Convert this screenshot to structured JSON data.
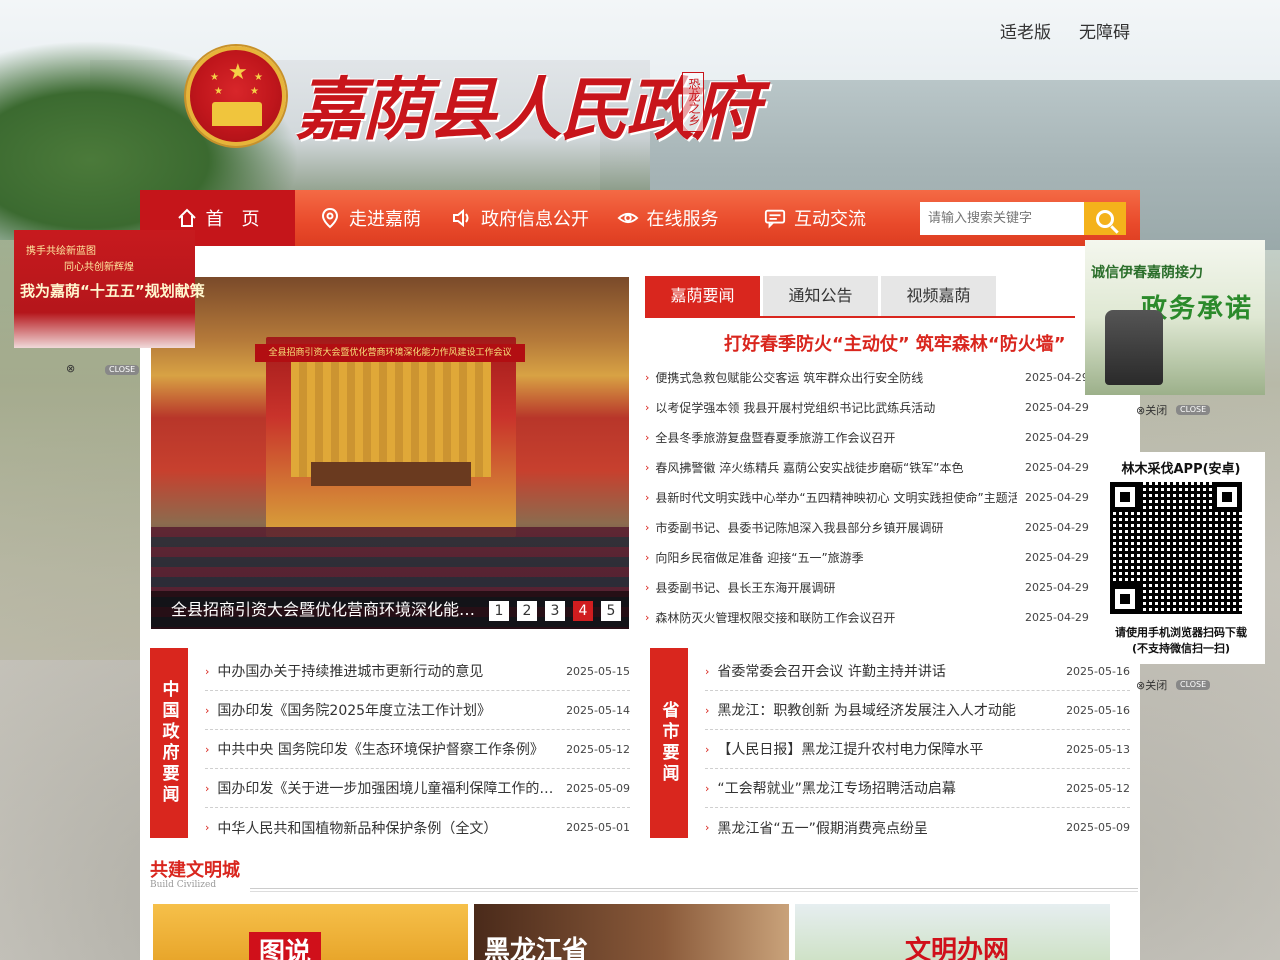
{
  "header": {
    "site_title": "嘉荫县人民政府",
    "seal_text": "恐龙之乡",
    "top_links": [
      "适老版",
      "无障碍"
    ]
  },
  "nav": {
    "items": [
      {
        "label": "首　页",
        "icon": "home-icon"
      },
      {
        "label": "走进嘉荫",
        "icon": "location-pin-icon"
      },
      {
        "label": "政府信息公开",
        "icon": "speaker-icon"
      },
      {
        "label": "在线服务",
        "icon": "eye-icon"
      },
      {
        "label": "互动交流",
        "icon": "chat-icon"
      }
    ],
    "search_placeholder": "请输入搜索关键字"
  },
  "slider": {
    "banner_text": "全县招商引资大会暨优化营商环境深化能力作风建设工作会议",
    "caption": "全县招商引资大会暨优化营商环境深化能力作风建设工作会议",
    "dots": [
      "1",
      "2",
      "3",
      "4",
      "5"
    ],
    "active_dot": 3
  },
  "news_tabs": {
    "tabs": [
      "嘉荫要闻",
      "通知公告",
      "视频嘉荫"
    ],
    "headline": "打好春季防火“主动仗” 筑牢森林“防火墙”",
    "items": [
      {
        "title": "便携式急救包赋能公交客运 筑牢群众出行安全防线",
        "date": "2025-04-29"
      },
      {
        "title": "以考促学强本领 我县开展村党组织书记比武练兵活动",
        "date": "2025-04-29"
      },
      {
        "title": "全县冬季旅游复盘暨春夏季旅游工作会议召开",
        "date": "2025-04-29"
      },
      {
        "title": "春风拂警徽 淬火练精兵 嘉荫公安实战徒步磨砺“铁军”本色",
        "date": "2025-04-29"
      },
      {
        "title": "县新时代文明实践中心举办“五四精神映初心 文明实践担使命”主题活动",
        "date": "2025-04-29"
      },
      {
        "title": "市委副书记、县委书记陈旭深入我县部分乡镇开展调研",
        "date": "2025-04-29"
      },
      {
        "title": "向阳乡民宿做足准备 迎接“五一”旅游季",
        "date": "2025-04-29"
      },
      {
        "title": "县委副书记、县长王东海开展调研",
        "date": "2025-04-29"
      },
      {
        "title": "森林防灭火管理权限交接和联防工作会议召开",
        "date": "2025-04-29"
      }
    ]
  },
  "china_news": {
    "tag": "中国政府要闻",
    "items": [
      {
        "title": "中办国办关于持续推进城市更新行动的意见",
        "date": "2025-05-15"
      },
      {
        "title": "国办印发《国务院2025年度立法工作计划》",
        "date": "2025-05-14"
      },
      {
        "title": "中共中央 国务院印发《生态环境保护督察工作条例》",
        "date": "2025-05-12"
      },
      {
        "title": "国办印发《关于进一步加强困境儿童福利保障工作的意见》",
        "date": "2025-05-09"
      },
      {
        "title": "中华人民共和国植物新品种保护条例（全文）",
        "date": "2025-05-01"
      }
    ]
  },
  "province_news": {
    "tag": "省市要闻",
    "items": [
      {
        "title": "省委常委会召开会议 许勤主持并讲话",
        "date": "2025-05-16"
      },
      {
        "title": "黑龙江：职教创新 为县域经济发展注入人才动能",
        "date": "2025-05-16"
      },
      {
        "title": "【人民日报】黑龙江提升农村电力保障水平",
        "date": "2025-05-13"
      },
      {
        "title": "“工会帮就业”黑龙江专场招聘活动启幕",
        "date": "2025-05-12"
      },
      {
        "title": "黑龙江省“五一”假期消费亮点纷呈",
        "date": "2025-05-09"
      }
    ]
  },
  "civilized": {
    "title": "共建文明城",
    "subtitle": "Build Civilized",
    "promos": [
      "图说",
      "黑龙江省",
      "文明办网"
    ]
  },
  "float_left": {
    "line1": "携手共绘新蓝图",
    "line2": "同心共创新辉煌",
    "line3": "我为嘉荫“十五五”规划献策",
    "close_label": "CLOSE"
  },
  "float_right1": {
    "line1": "诚信伊春嘉荫接力",
    "line2": "政务承诺",
    "close_text": "关闭",
    "close_label": "CLOSE"
  },
  "float_right2": {
    "title": "林木采伐APP(安卓)",
    "hint1": "请使用手机浏览器扫码下载",
    "hint2": "(不支持微信扫一扫)",
    "close_text": "关闭",
    "close_label": "CLOSE"
  },
  "colors": {
    "brand_red": "#d9261e",
    "nav_orange": "#e94a2b",
    "search_yellow": "#f4b21b"
  }
}
